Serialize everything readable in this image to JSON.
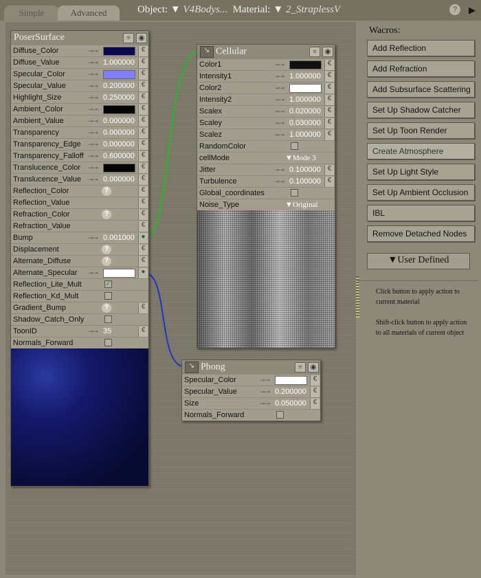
{
  "tabs": {
    "simple": "Simple",
    "advanced": "Advanced"
  },
  "header": {
    "object_label": "Object:",
    "object_value": "V4Bodys...",
    "material_label": "Material:",
    "material_value": "2_StraplessV",
    "help": "?"
  },
  "poser_surface": {
    "title": "PoserSurface",
    "rows": [
      {
        "label": "Diffuse_Color",
        "type": "color",
        "color": "#0a0a50",
        "link": true
      },
      {
        "label": "Diffuse_Value",
        "type": "num",
        "value": "1.000000",
        "link": true
      },
      {
        "label": "Specular_Color",
        "type": "color",
        "color": "#8080ff",
        "link": true
      },
      {
        "label": "Specular_Value",
        "type": "num",
        "value": "0.200000",
        "link": true
      },
      {
        "label": "Highlight_Size",
        "type": "num",
        "value": "0.250000",
        "link": true
      },
      {
        "label": "Ambient_Color",
        "type": "color",
        "color": "#050505",
        "link": true
      },
      {
        "label": "Ambient_Value",
        "type": "num",
        "value": "0.000000",
        "link": true
      },
      {
        "label": "Transparency",
        "type": "num",
        "value": "0.000000",
        "link": true
      },
      {
        "label": "Transparency_Edge",
        "type": "num",
        "value": "0.000000",
        "link": true
      },
      {
        "label": "Transparency_Falloff",
        "type": "num",
        "value": "0.600000",
        "link": true
      },
      {
        "label": "Translucence_Color",
        "type": "color",
        "color": "#050505",
        "link": true
      },
      {
        "label": "Translucence_Value",
        "type": "num",
        "value": "0.000000",
        "link": true
      },
      {
        "label": "Reflection_Color",
        "type": "help"
      },
      {
        "label": "Reflection_Value",
        "type": "none"
      },
      {
        "label": "Refraction_Color",
        "type": "help"
      },
      {
        "label": "Refraction_Value",
        "type": "none"
      },
      {
        "label": "Bump",
        "type": "num",
        "value": "0.001000",
        "link": true,
        "connected": true
      },
      {
        "label": "Displacement",
        "type": "help"
      },
      {
        "label": "Alternate_Diffuse",
        "type": "help"
      },
      {
        "label": "Alternate_Specular",
        "type": "color",
        "color": "#ffffff",
        "link": true,
        "connected": true
      },
      {
        "label": "Reflection_Lite_Mult",
        "type": "check",
        "checked": true
      },
      {
        "label": "Reflection_Kd_Mult",
        "type": "check",
        "checked": false
      },
      {
        "label": "Gradient_Bump",
        "type": "help"
      },
      {
        "label": "Shadow_Catch_Only",
        "type": "check",
        "checked": false
      },
      {
        "label": "ToonID",
        "type": "num",
        "value": "35",
        "link": true
      },
      {
        "label": "Normals_Forward",
        "type": "check",
        "checked": false
      }
    ]
  },
  "cellular": {
    "title": "Cellular",
    "rows": [
      {
        "label": "Color1",
        "type": "color",
        "color": "#111111",
        "link": true
      },
      {
        "label": "Intensity1",
        "type": "num",
        "value": "1.000000",
        "link": true
      },
      {
        "label": "Color2",
        "type": "color",
        "color": "#ffffff",
        "link": true
      },
      {
        "label": "Intensity2",
        "type": "num",
        "value": "1.000000",
        "link": true
      },
      {
        "label": "Scalex",
        "type": "num",
        "value": "0.020000",
        "link": true
      },
      {
        "label": "Scaley",
        "type": "num",
        "value": "0.030000",
        "link": true
      },
      {
        "label": "Scalez",
        "type": "num",
        "value": "1.000000",
        "link": true
      },
      {
        "label": "RandomColor",
        "type": "check",
        "checked": false
      },
      {
        "label": "cellMode",
        "type": "dropdown",
        "value": "Mode 3"
      },
      {
        "label": "Jitter",
        "type": "num",
        "value": "0.100000",
        "link": true
      },
      {
        "label": "Turbulence",
        "type": "num",
        "value": "0.100000",
        "link": true
      },
      {
        "label": "Global_coordinates",
        "type": "check",
        "checked": false
      },
      {
        "label": "Noise_Type",
        "type": "dropdown",
        "value": "Original"
      }
    ]
  },
  "phong": {
    "title": "Phong",
    "rows": [
      {
        "label": "Specular_Color",
        "type": "color",
        "color": "#ffffff",
        "link": true
      },
      {
        "label": "Specular_Value",
        "type": "num",
        "value": "0.200000",
        "link": true
      },
      {
        "label": "Size",
        "type": "num",
        "value": "0.050000",
        "link": true
      },
      {
        "label": "Normals_Forward",
        "type": "check",
        "checked": false
      }
    ]
  },
  "wacros": {
    "title": "Wacros:",
    "buttons": [
      "Add Reflection",
      "Add Refraction",
      "Add Subsurface Scattering",
      "Set Up Shadow Catcher",
      "Set Up Toon Render",
      "Create Atmosphere",
      "Set Up Light Style",
      "Set Up Ambient Occlusion",
      "IBL",
      "Remove Detached Nodes"
    ],
    "user_defined": "User Defined",
    "note1": "Click button to apply action to current material",
    "note2": "Shift-click button to apply action to all materials of current object"
  },
  "colors": {
    "wire_green": "#22bb22",
    "wire_blue": "#2233cc"
  }
}
